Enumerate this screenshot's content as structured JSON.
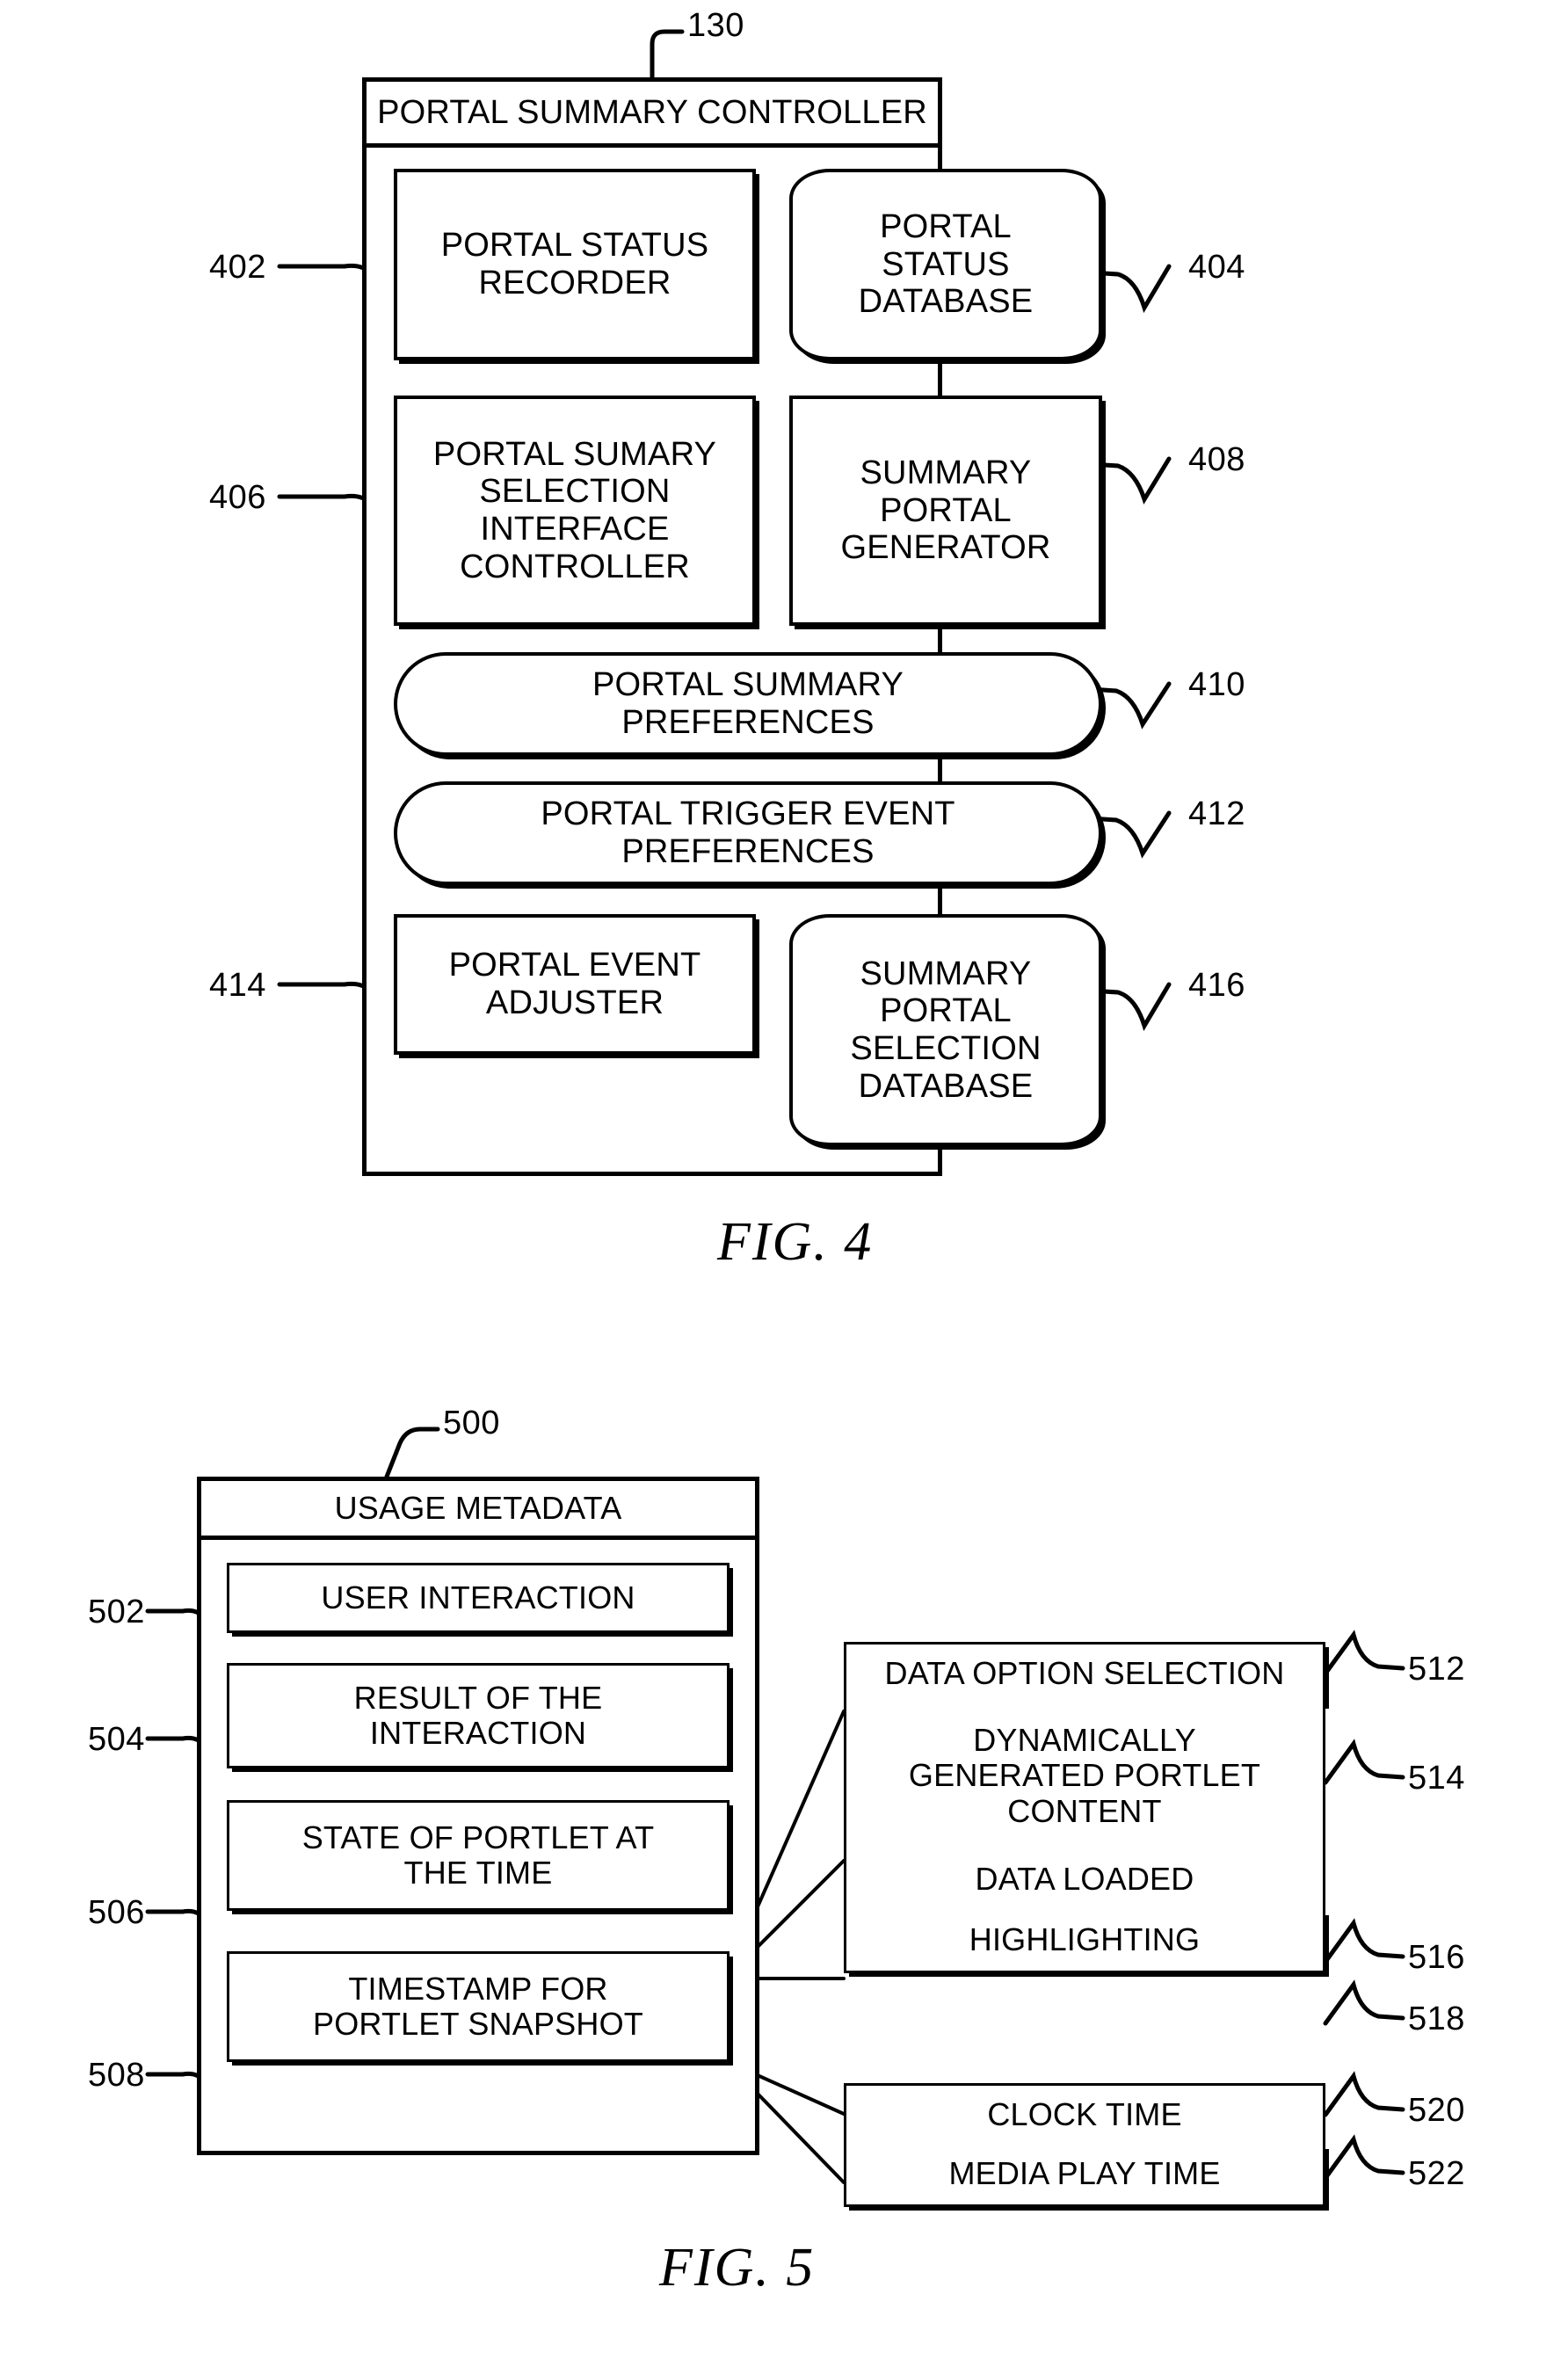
{
  "figure4": {
    "caption": "FIG. 4",
    "outer_ref": "130",
    "title": "PORTAL SUMMARY CONTROLLER",
    "blocks": [
      {
        "ref": "402",
        "label": "PORTAL STATUS\nRECORDER",
        "shape": "rect"
      },
      {
        "ref": "404",
        "label": "PORTAL\nSTATUS\nDATABASE",
        "shape": "database"
      },
      {
        "ref": "406",
        "label": "PORTAL SUMARY\nSELECTION\nINTERFACE\nCONTROLLER",
        "shape": "rect"
      },
      {
        "ref": "408",
        "label": "SUMMARY\nPORTAL\nGENERATOR",
        "shape": "rect"
      },
      {
        "ref": "410",
        "label": "PORTAL SUMMARY\nPREFERENCES",
        "shape": "pill"
      },
      {
        "ref": "412",
        "label": "PORTAL TRIGGER EVENT\nPREFERENCES",
        "shape": "pill"
      },
      {
        "ref": "414",
        "label": "PORTAL EVENT\nADJUSTER",
        "shape": "rect"
      },
      {
        "ref": "416",
        "label": "SUMMARY\nPORTAL\nSELECTION\nDATABASE",
        "shape": "database"
      }
    ]
  },
  "figure5": {
    "caption": "FIG. 5",
    "outer_ref": "500",
    "title": "USAGE METADATA",
    "left_blocks": [
      {
        "ref": "502",
        "label": "USER INTERACTION"
      },
      {
        "ref": "504",
        "label": "RESULT OF THE\nINTERACTION"
      },
      {
        "ref": "506",
        "label": "STATE OF PORTLET AT\nTHE TIME"
      },
      {
        "ref": "508",
        "label": "TIMESTAMP FOR\nPORTLET SNAPSHOT"
      }
    ],
    "right_group_state": [
      {
        "ref": "512",
        "label": "DATA OPTION SELECTION"
      },
      {
        "ref": "514",
        "label": "DYNAMICALLY\nGENERATED PORTLET\nCONTENT"
      },
      {
        "ref": "516",
        "label": "DATA LOADED"
      },
      {
        "ref": "518",
        "label": "HIGHLIGHTING"
      }
    ],
    "right_group_time": [
      {
        "ref": "520",
        "label": "CLOCK TIME"
      },
      {
        "ref": "522",
        "label": "MEDIA PLAY TIME"
      }
    ]
  },
  "colors": {
    "ink": "#000000",
    "paper": "#ffffff"
  }
}
